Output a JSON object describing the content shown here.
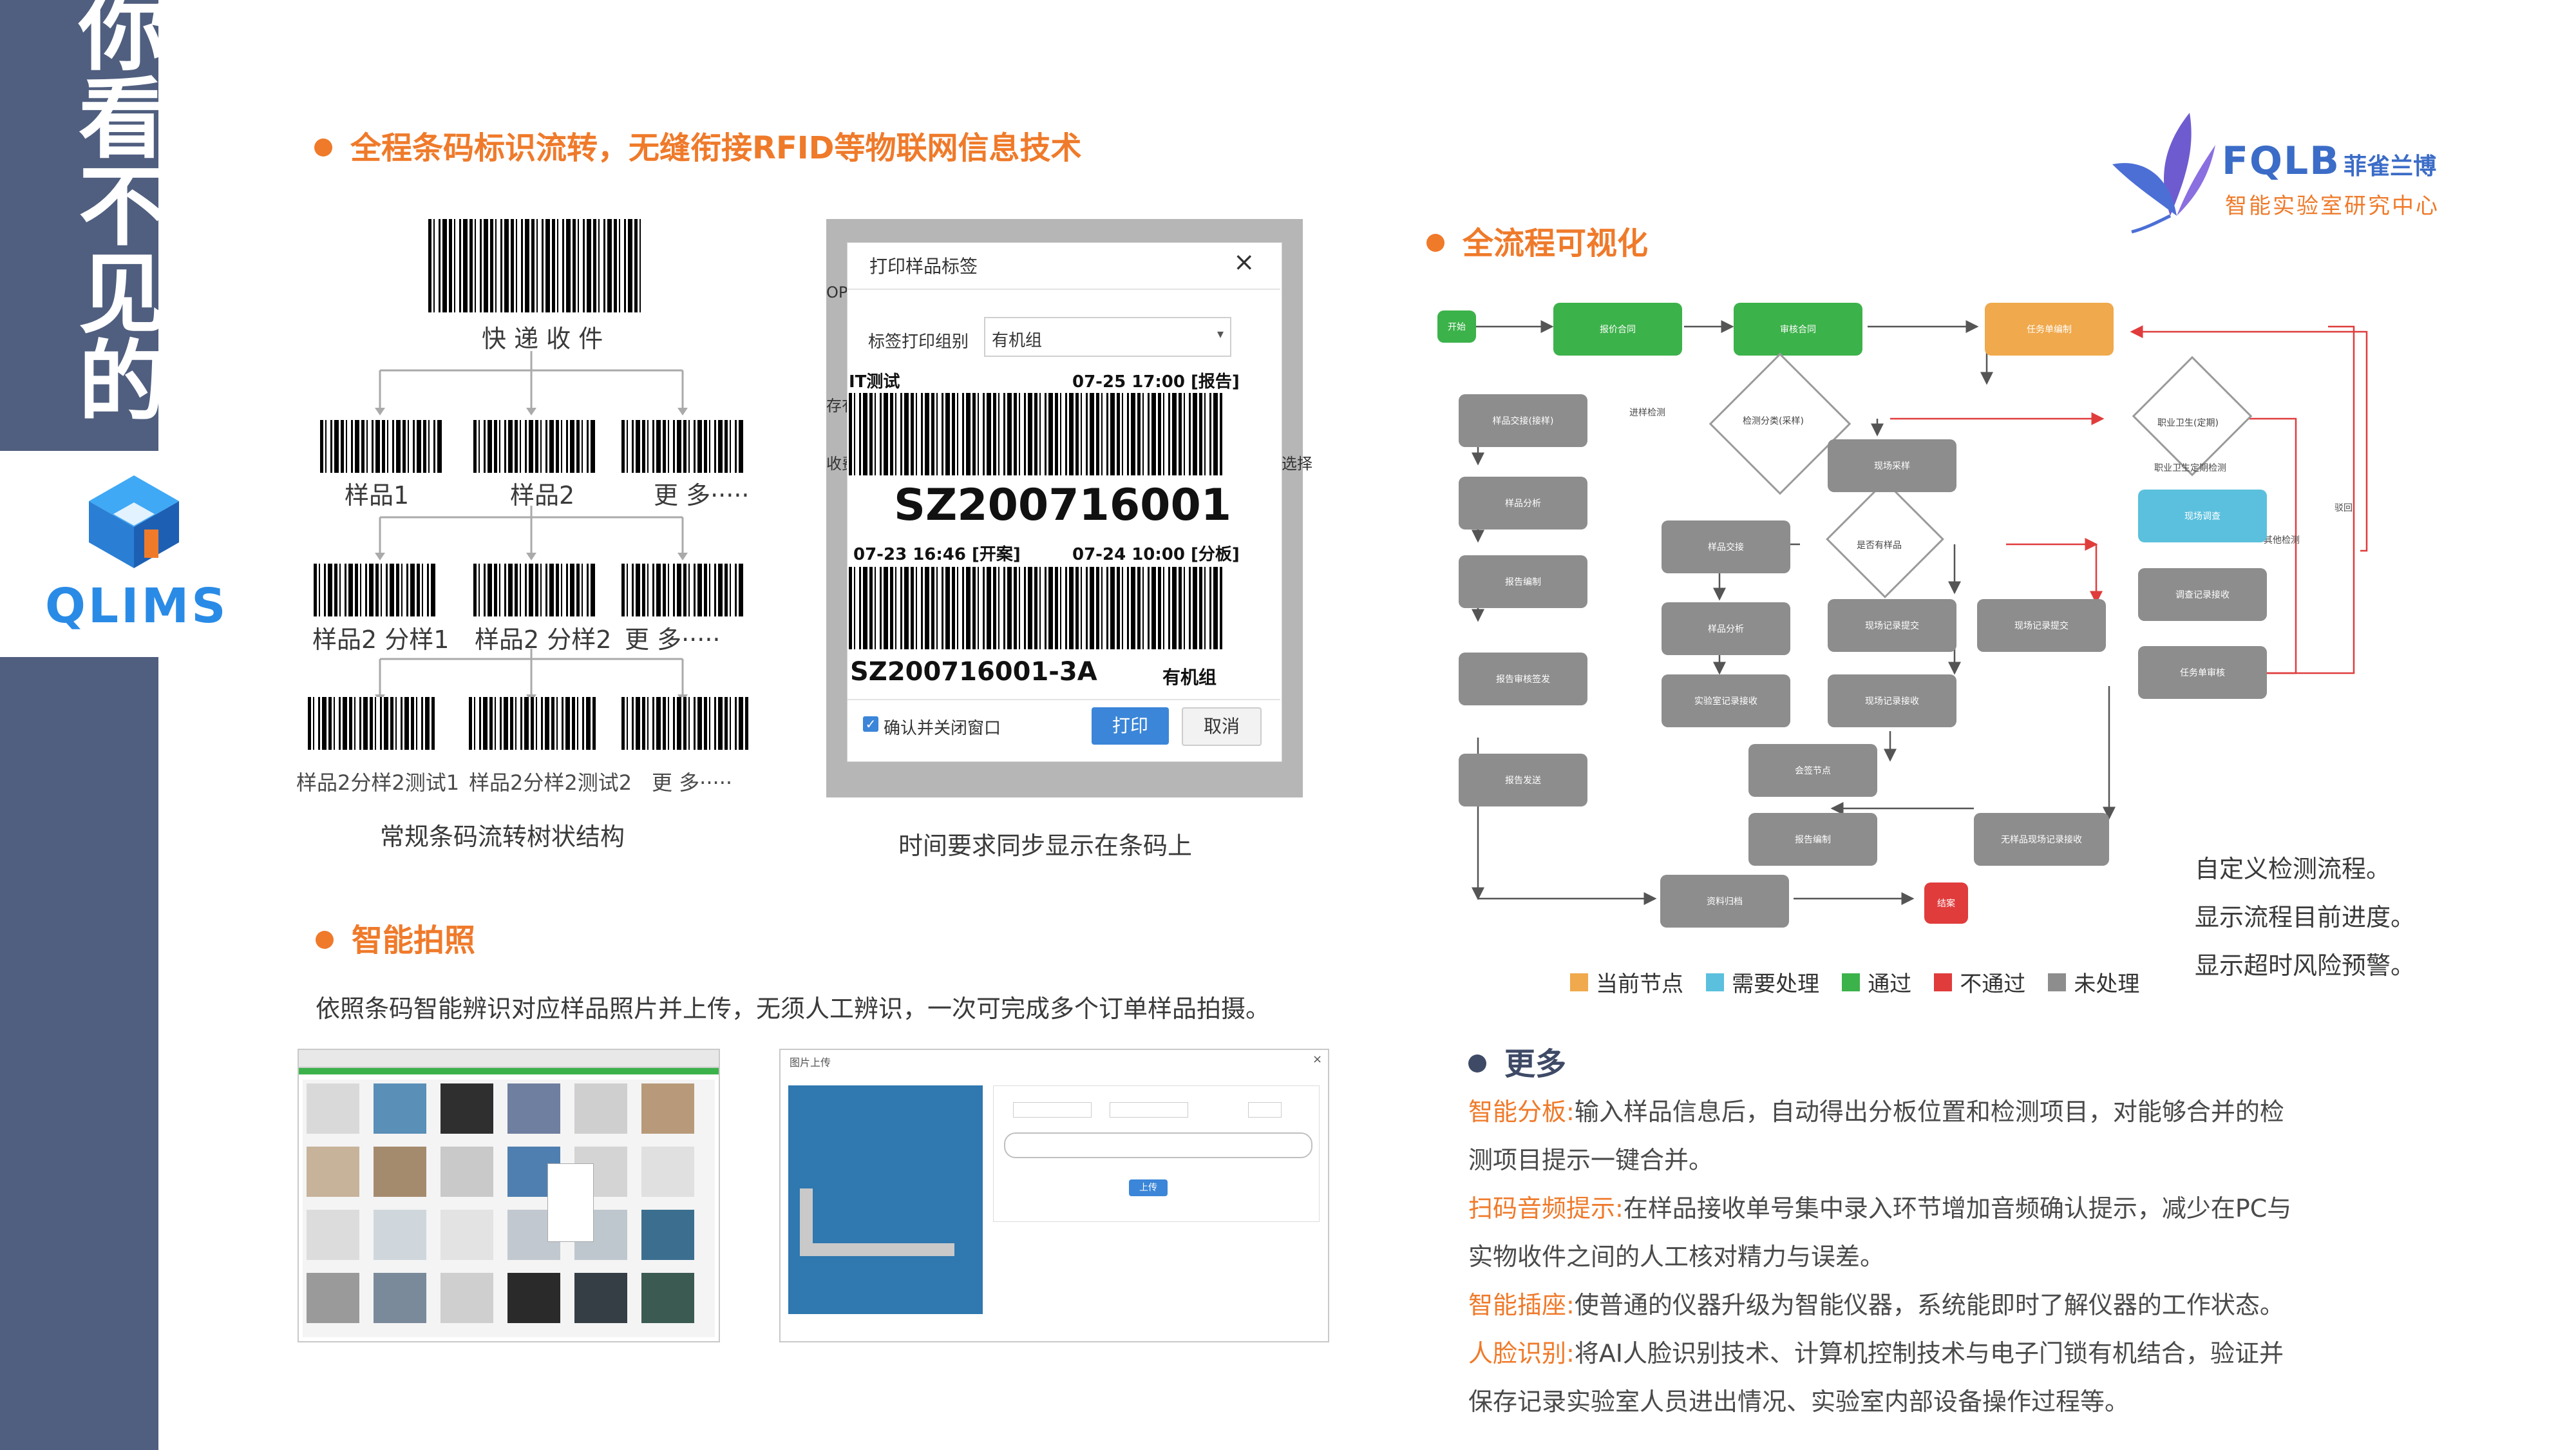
{
  "side": {
    "title_chars": [
      "你",
      "看",
      "不",
      "见",
      "的"
    ],
    "brand": "QLIMS"
  },
  "logo": {
    "name": "FQLB",
    "name_cn": "菲雀兰博",
    "subtitle": "智能实验室研究中心"
  },
  "barcode_section": {
    "title": "全程条码标识流转，无缝衔接RFID等物联网信息技术",
    "tree": {
      "root": "快 递 收 件",
      "level1": [
        "样品1",
        "样品2",
        "更 多·····"
      ],
      "level2": [
        "样品2 分样1",
        "样品2 分样2",
        "更 多·····"
      ],
      "level3": [
        "样品2分样2测试1",
        "样品2分样2测试2",
        "更 多·····"
      ]
    },
    "tree_caption": "常规条码流转树状结构",
    "dialog": {
      "title": "打印样品标签",
      "close": "×",
      "group_label": "标签打印组别",
      "group_value": "有机组",
      "left_edge": [
        "OPE",
        "存有",
        "收费"
      ],
      "right_edge": "选择",
      "label_tl": "IT测试",
      "label_tr": "07-25 17:00 [报告]",
      "code_main": "SZ200716001",
      "time_left": "07-23 16:46 [开案]",
      "time_right": "07-24 10:00 [分板]",
      "code_sub": "SZ200716001-3A",
      "group_sub": "有机组",
      "checkbox": "确认并关闭窗口",
      "print_btn": "打印",
      "cancel_btn": "取消"
    },
    "dialog_caption": "时间要求同步显示在条码上"
  },
  "photo_section": {
    "title": "智能拍照",
    "desc": "依照条码智能辨识对应样品照片并上传，无须人工辨识，一次可完成多个订单样品拍摄。",
    "upload_window_title": "图片上传",
    "upload_btn": "上传"
  },
  "flow_section": {
    "title": "全流程可视化",
    "nodes": {
      "start": "开始",
      "n1": "报价合同",
      "n2": "审核合同",
      "n3": "任务单编制",
      "n4": "样品交接(接样)",
      "n5": "样品分析",
      "n6": "报告编制",
      "n7": "报告审核签发",
      "n8": "报告发送",
      "n9": "资料归档",
      "end": "结案",
      "d1": "检测分类(采样)",
      "d2": "是否有样品",
      "d3": "职业卫生(定期)",
      "e1": "进样检测",
      "e2": "职业卫生定期检测",
      "e3": "其他检测",
      "e4": "驳回",
      "m1": "现场采样",
      "m2": "样品交接",
      "m3": "样品分析",
      "m4": "实验室记录接收",
      "m5": "现场记录提交",
      "m6": "现场记录接收",
      "m7": "现场记录提交",
      "m8": "会签节点",
      "m9": "报告编制",
      "m10": "无样品现场记录接收",
      "r1": "现场调查",
      "r2": "调查记录接收",
      "r3": "任务单审核"
    },
    "legend": [
      "当前节点",
      "需要处理",
      "通过",
      "不通过",
      "未处理"
    ],
    "legend_colors": [
      "#f0a94c",
      "#5bc0de",
      "#3cb24a",
      "#e03c3c",
      "#8d8d8d"
    ],
    "notes": [
      "自定义检测流程。",
      "显示流程目前进度。",
      "显示超时风险预警。"
    ]
  },
  "more_section": {
    "title": "更多",
    "items": [
      {
        "key": "智能分板:",
        "text": "输入样品信息后，自动得出分板位置和检测项目，对能够合并的检",
        "cont": "测项目提示一键合并。"
      },
      {
        "key": "扫码音频提示:",
        "text": "在样品接收单号集中录入环节增加音频确认提示，减少在PC与",
        "cont": "实物收件之间的人工核对精力与误差。"
      },
      {
        "key": "智能插座:",
        "text": "使普通的仪器升级为智能仪器，系统能即时了解仪器的工作状态。",
        "cont": ""
      },
      {
        "key": "人脸识别:",
        "text": "将AI人脸识别技术、计算机控制技术与电子门锁有机结合，验证并",
        "cont": "保存记录实验室人员进出情况、实验室内部设备操作过程等。"
      }
    ]
  }
}
